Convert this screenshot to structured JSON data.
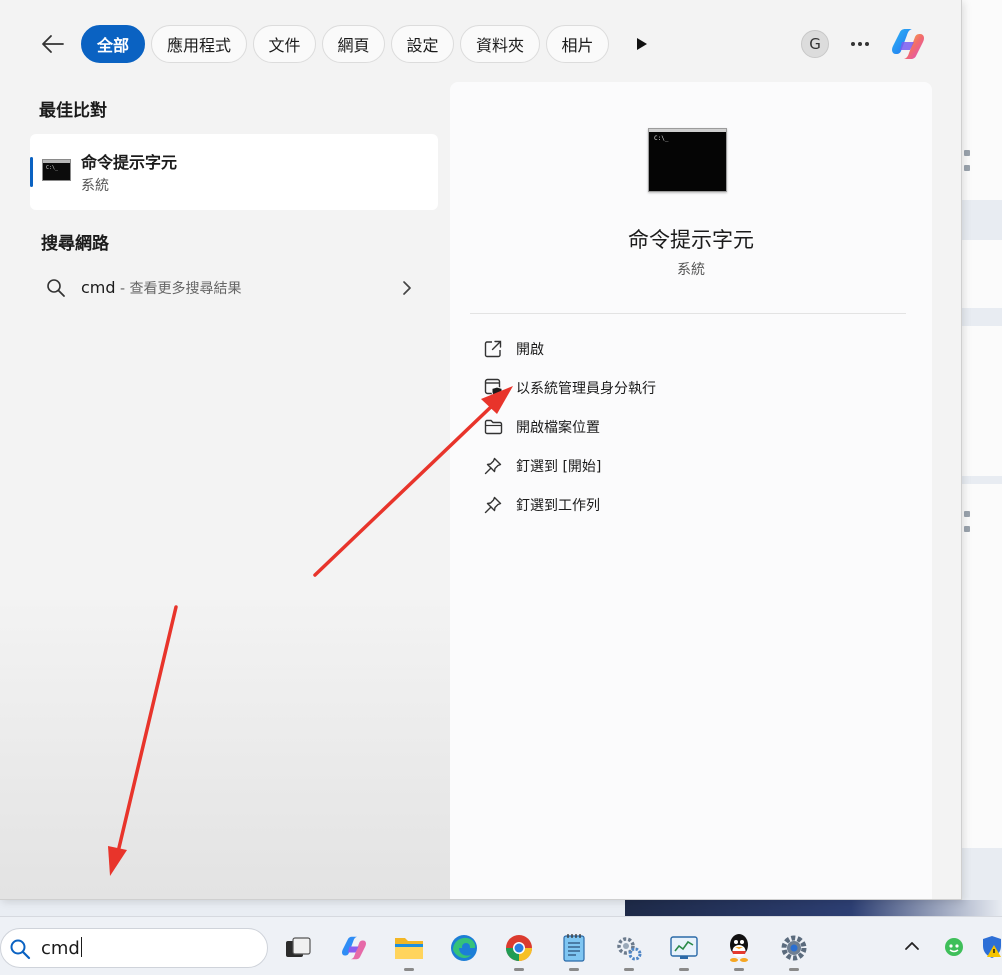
{
  "filter_bar": {
    "back_icon": "arrow-left-icon",
    "tabs": [
      {
        "label": "全部",
        "active": true
      },
      {
        "label": "應用程式",
        "active": false
      },
      {
        "label": "文件",
        "active": false
      },
      {
        "label": "網頁",
        "active": false
      },
      {
        "label": "設定",
        "active": false
      },
      {
        "label": "資料夾",
        "active": false
      },
      {
        "label": "相片",
        "active": false
      }
    ],
    "more_filters_icon": "play-icon",
    "account_initial": "G",
    "more_options_icon": "ellipsis-icon",
    "copilot_icon": "copilot-icon"
  },
  "best_match": {
    "heading": "最佳比對",
    "name": "命令提示字元",
    "category": "系統",
    "icon": "command-prompt-icon"
  },
  "web_search": {
    "heading": "搜尋網路",
    "query": "cmd",
    "hint": " - 查看更多搜尋結果",
    "icon": "search-icon"
  },
  "detail": {
    "title": "命令提示字元",
    "subtitle": "系統",
    "icon": "command-prompt-icon",
    "actions": [
      {
        "label": "開啟",
        "icon": "open-external-icon"
      },
      {
        "label": "以系統管理員身分執行",
        "icon": "run-as-admin-shield-icon"
      },
      {
        "label": "開啟檔案位置",
        "icon": "folder-icon"
      },
      {
        "label": "釘選到 [開始]",
        "icon": "pin-icon"
      },
      {
        "label": "釘選到工作列",
        "icon": "pin-icon"
      }
    ]
  },
  "taskbar": {
    "search_value": "cmd",
    "apps": [
      "task-view-icon",
      "copilot-icon",
      "file-explorer-icon",
      "edge-icon",
      "chrome-icon",
      "notepad-icon",
      "control-panel-icon",
      "performance-monitor-icon",
      "qq-icon",
      "settings-icon"
    ],
    "tray": [
      "chevron-up-icon",
      "tray-app-icon",
      "security-warning-icon"
    ]
  },
  "colors": {
    "accent": "#0a62c2",
    "annotation_arrow": "#e8342b"
  }
}
